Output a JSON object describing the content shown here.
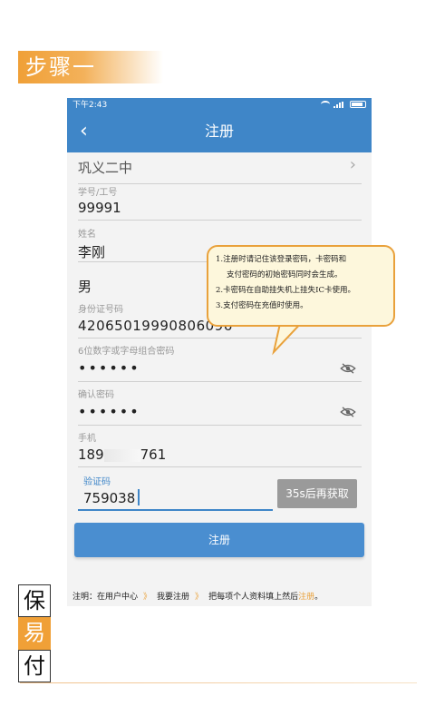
{
  "banner": {
    "text": "步骤一"
  },
  "status_bar": {
    "time": "下午2:43"
  },
  "nav": {
    "back_icon": "‹",
    "title": "注册"
  },
  "form": {
    "school": {
      "value": "巩义二中",
      "chevron": "›"
    },
    "student_id": {
      "label": "学号/工号",
      "value": "99991"
    },
    "name": {
      "label": "姓名",
      "value": "李刚"
    },
    "gender": {
      "value": "男"
    },
    "id_card": {
      "label": "身份证号码",
      "value": "42065019990806096"
    },
    "password": {
      "label": "6位数字或字母组合密码",
      "value": "••••••"
    },
    "confirm_password": {
      "label": "确认密码",
      "value": "••••••"
    },
    "phone": {
      "label": "手机",
      "value_prefix": "189",
      "value_suffix": "761"
    },
    "verify_code": {
      "label": "验证码",
      "value": "759038",
      "resend_label": "35s后再获取"
    },
    "submit_label": "注册"
  },
  "callout": {
    "line1": "1.注册时请记住该登录密码，卡密码和",
    "line2": "支付密码的初始密码同时会生成。",
    "line3": "2.卡密码在自助挂失机上挂失IC卡使用。",
    "line4": "3.支付密码在充值时使用。"
  },
  "note": {
    "prefix": "注明：在用户中心",
    "step1": "我要注册",
    "middle": "把每项个人资料填上然后",
    "action": "注册",
    "end": "。",
    "chevron": "》"
  },
  "side_chars": [
    "保",
    "易",
    "付"
  ],
  "colors": {
    "primary": "#3f86c8",
    "accent": "#f0a037"
  }
}
